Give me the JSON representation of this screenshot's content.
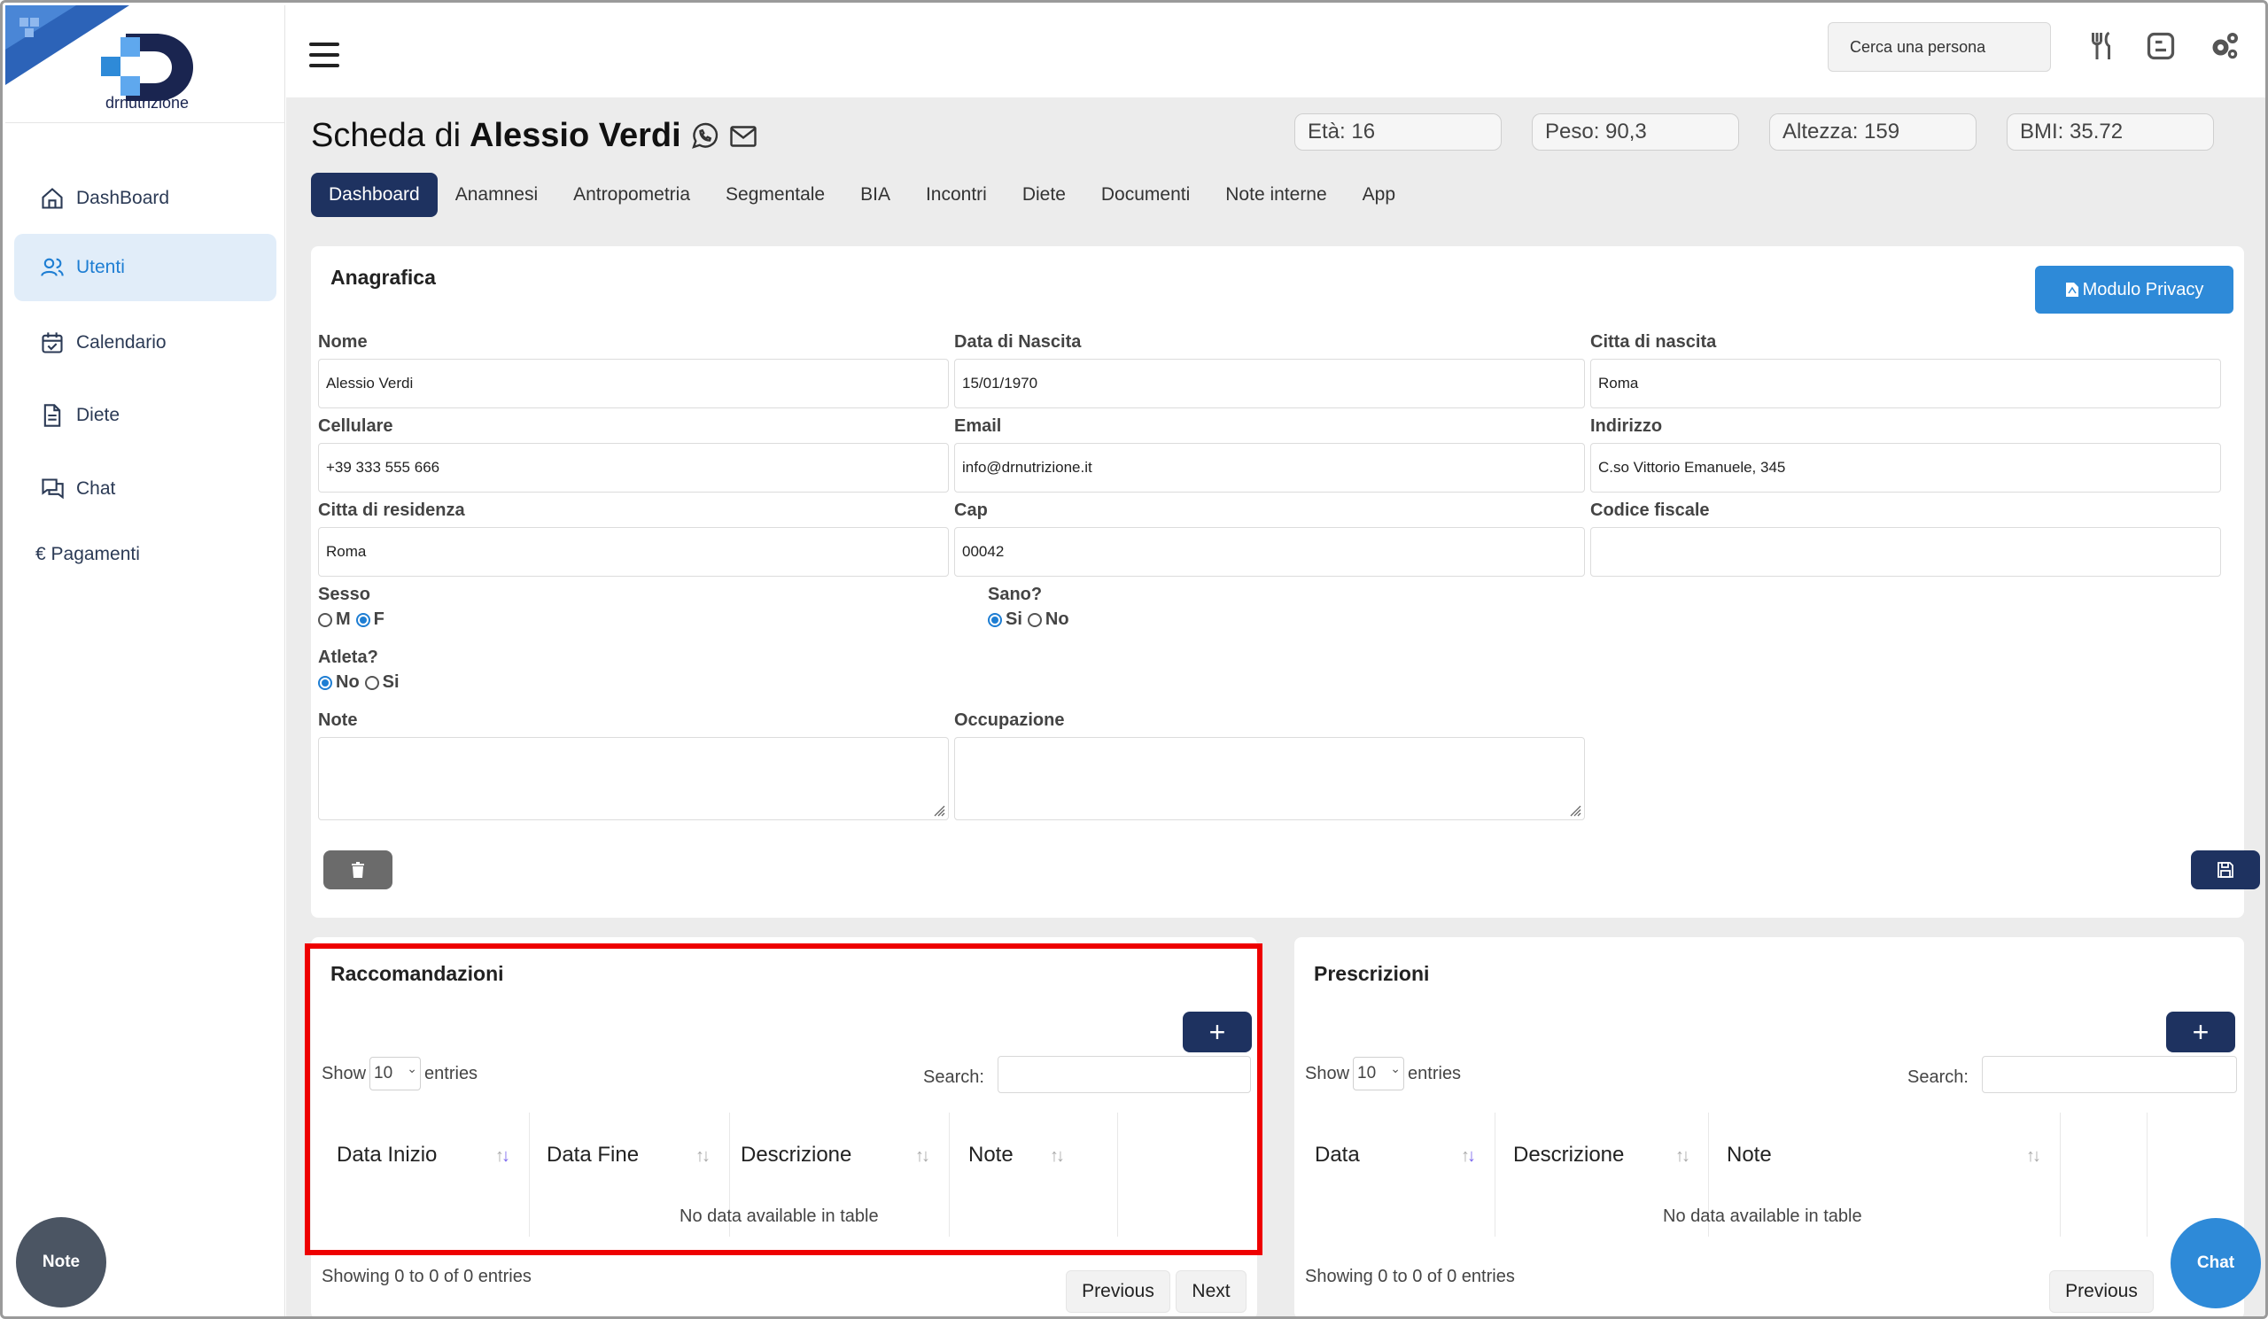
{
  "brand": {
    "name": "drnutrizione",
    "primary_color": "#1e3260",
    "accent_color": "#2e8ad8"
  },
  "sidebar": {
    "items": [
      {
        "label": "DashBoard",
        "icon": "home-icon"
      },
      {
        "label": "Utenti",
        "icon": "users-icon",
        "active": true
      },
      {
        "label": "Calendario",
        "icon": "calendar-icon"
      },
      {
        "label": "Diete",
        "icon": "document-icon"
      },
      {
        "label": "Chat",
        "icon": "chat-icon"
      },
      {
        "label": "€ Pagamenti"
      }
    ],
    "note_button": "Note"
  },
  "topbar": {
    "search_placeholder": "Cerca una persona",
    "icons": [
      "fork-knife-icon",
      "blog-icon",
      "settings-icon"
    ]
  },
  "patient": {
    "prefix": "Scheda di",
    "name": "Alessio Verdi",
    "stats": [
      "Età: 16",
      "Peso: 90,3",
      "Altezza: 159",
      "BMI: 35.72"
    ]
  },
  "tabs": [
    "Dashboard",
    "Anamnesi",
    "Antropometria",
    "Segmentale",
    "BIA",
    "Incontri",
    "Diete",
    "Documenti",
    "Note interne",
    "App"
  ],
  "anagrafica": {
    "title": "Anagrafica",
    "privacy_button": "Modulo Privacy",
    "fields": {
      "nome": {
        "label": "Nome",
        "value": "Alessio Verdi"
      },
      "data_nascita": {
        "label": "Data di Nascita",
        "value": "15/01/1970"
      },
      "citta_nascita": {
        "label": "Citta di nascita",
        "value": "Roma"
      },
      "cellulare": {
        "label": "Cellulare",
        "value": "+39 333 555 666"
      },
      "email": {
        "label": "Email",
        "value": "info@drnutrizione.it"
      },
      "indirizzo": {
        "label": "Indirizzo",
        "value": "C.so Vittorio Emanuele, 345"
      },
      "citta_residenza": {
        "label": "Citta di residenza",
        "value": "Roma"
      },
      "cap": {
        "label": "Cap",
        "value": "00042"
      },
      "codice_fiscale": {
        "label": "Codice fiscale",
        "value": ""
      },
      "note": {
        "label": "Note",
        "value": ""
      },
      "occupazione": {
        "label": "Occupazione",
        "value": ""
      }
    },
    "sesso": {
      "label": "Sesso",
      "options": [
        "M",
        "F"
      ],
      "selected": "F"
    },
    "sano": {
      "label": "Sano?",
      "options": [
        "Si",
        "No"
      ],
      "selected": "Si"
    },
    "atleta": {
      "label": "Atleta?",
      "options": [
        "No",
        "Si"
      ],
      "selected": "No"
    }
  },
  "raccomandazioni": {
    "title": "Raccomandazioni",
    "show": "Show",
    "entries_value": "10",
    "entries": "entries",
    "search_label": "Search:",
    "columns": [
      "Data Inizio",
      "Data Fine",
      "Descrizione",
      "Note"
    ],
    "empty": "No data available in table",
    "footer": "Showing 0 to 0 of 0 entries",
    "prev": "Previous",
    "next": "Next"
  },
  "prescrizioni": {
    "title": "Prescrizioni",
    "show": "Show",
    "entries_value": "10",
    "entries": "entries",
    "search_label": "Search:",
    "columns": [
      "Data",
      "Descrizione",
      "Note"
    ],
    "empty": "No data available in table",
    "footer": "Showing 0 to 0 of 0 entries",
    "prev": "Previous"
  },
  "chat_button": "Chat"
}
